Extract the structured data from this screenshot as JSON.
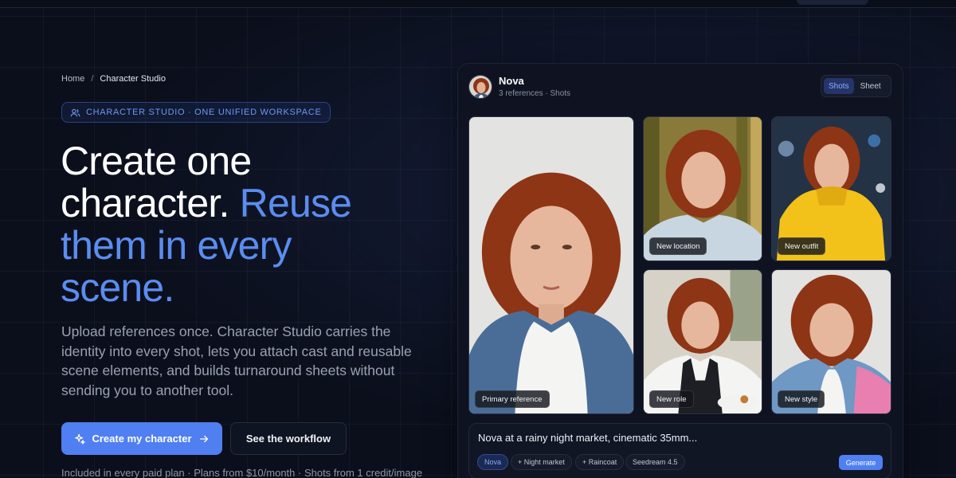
{
  "breadcrumb": {
    "home": "Home",
    "separator": "/",
    "current": "Character Studio"
  },
  "eyebrow": {
    "icon": "users-icon",
    "label": "CHARACTER STUDIO · ONE UNIFIED WORKSPACE"
  },
  "hero": {
    "title_line1": "Create one",
    "title_line2_plain": "character. ",
    "title_line2_accent": "Reuse",
    "title_line3_accent": "them in every",
    "title_line4_accent": "scene.",
    "subtitle": "Upload references once. Character Studio carries the identity into every shot, lets you attach cast and reusable scene elements, and builds turnaround sheets without sending you to another tool."
  },
  "cta": {
    "primary_label": "Create my character",
    "primary_icon": "sparkle-icon",
    "primary_trailing_icon": "arrow-right-icon",
    "secondary_label": "See the workflow"
  },
  "footnote": "Included in every paid plan · Plans from $10/month · Shots from 1 credit/image",
  "panel": {
    "character_name": "Nova",
    "meta": "3 references · Shots",
    "view_options": [
      "Shots",
      "Sheet"
    ],
    "active_view": "Shots",
    "tiles": [
      {
        "label": "Primary reference"
      },
      {
        "label": "New location"
      },
      {
        "label": "New outfit"
      },
      {
        "label": "New role"
      },
      {
        "label": "New style"
      }
    ],
    "prompt": "Nova at a rainy night market, cinematic 35mm...",
    "tags": [
      "Nova",
      "+ Night market",
      "+ Raincoat",
      "Seedream 4.5"
    ],
    "generate_label": "Generate"
  },
  "colors": {
    "background": "#0b0f1c",
    "accent": "#5b8df0",
    "button": "#4f7ff0",
    "hair": "#8e3516",
    "outfit_yellow": "#f2c21a"
  }
}
